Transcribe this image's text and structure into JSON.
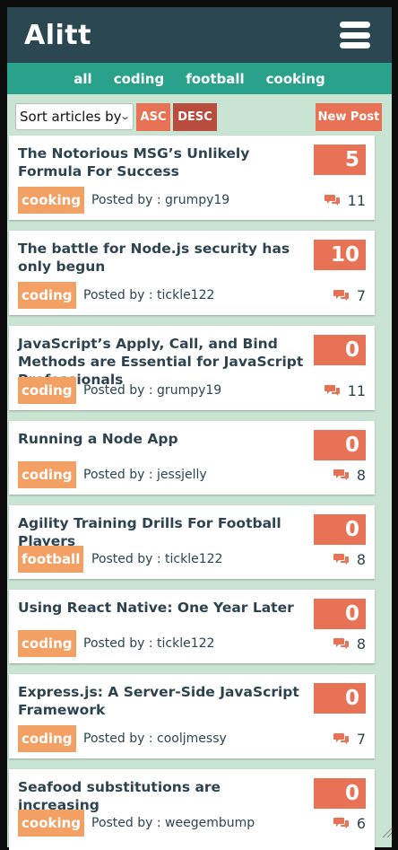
{
  "brand": "Alitt",
  "topics": [
    "all",
    "coding",
    "football",
    "cooking"
  ],
  "controls": {
    "sort_label": "Sort articles by",
    "asc_label": "ASC",
    "desc_label": "DESC",
    "new_post_label": "New Post"
  },
  "posted_prefix": "Posted by : ",
  "colors": {
    "header": "#2a4752",
    "topic_bar": "#2aa18b",
    "background": "#c9e4d2",
    "accent": "#e87255",
    "desc_active": "#b84c3d",
    "tag": "#f2a064"
  },
  "articles": [
    {
      "title": "The Notorious MSG’s Unlikely Formula For Success",
      "topic": "cooking",
      "author": "grumpy19",
      "votes": "5",
      "comments": "11"
    },
    {
      "title": "The battle for Node.js security has only begun",
      "topic": "coding",
      "author": "tickle122",
      "votes": "10",
      "comments": "7"
    },
    {
      "title": "JavaScript’s Apply, Call, and Bind Methods are Essential for JavaScript Professionals",
      "topic": "coding",
      "author": "grumpy19",
      "votes": "0",
      "comments": "11"
    },
    {
      "title": "Running a Node App",
      "topic": "coding",
      "author": "jessjelly",
      "votes": "0",
      "comments": "8"
    },
    {
      "title": "Agility Training Drills For Football Players",
      "topic": "football",
      "author": "tickle122",
      "votes": "0",
      "comments": "8"
    },
    {
      "title": "Using React Native: One Year Later",
      "topic": "coding",
      "author": "tickle122",
      "votes": "0",
      "comments": "8"
    },
    {
      "title": "Express.js: A Server-Side JavaScript Framework",
      "topic": "coding",
      "author": "cooljmessy",
      "votes": "0",
      "comments": "7"
    },
    {
      "title": "Seafood substitutions are increasing",
      "topic": "cooking",
      "author": "weegembump",
      "votes": "0",
      "comments": "6"
    }
  ]
}
